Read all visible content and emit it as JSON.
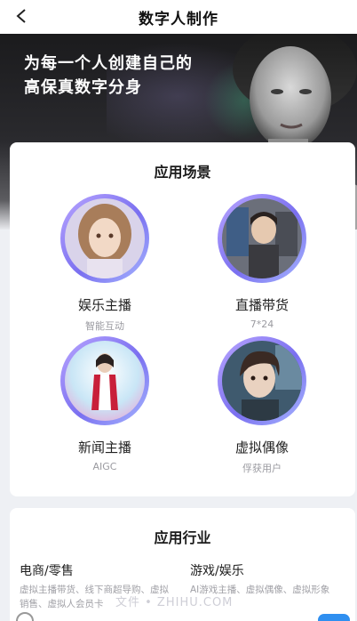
{
  "header": {
    "title": "数字人制作",
    "back_icon": "chevron-left-icon"
  },
  "hero": {
    "line1": "为每一个人创建自己的",
    "line2": "高保真数字分身"
  },
  "scenes": {
    "title": "应用场景",
    "items": [
      {
        "name": "娱乐主播",
        "sub": "智能互动"
      },
      {
        "name": "直播带货",
        "sub": "7*24"
      },
      {
        "name": "新闻主播",
        "sub": "AIGC"
      },
      {
        "name": "虚拟偶像",
        "sub": "俘获用户"
      }
    ]
  },
  "industries": {
    "title": "应用行业",
    "items": [
      {
        "name": "电商/零售",
        "desc": "虚拟主播带货、线下商超导购、虚拟销售、虚拟人会员卡"
      },
      {
        "name": "游戏/娱乐",
        "desc": "AI游戏主播、虚拟偶像、虚拟形象"
      }
    ]
  },
  "watermark": "文件 • ZHIHU.COM"
}
